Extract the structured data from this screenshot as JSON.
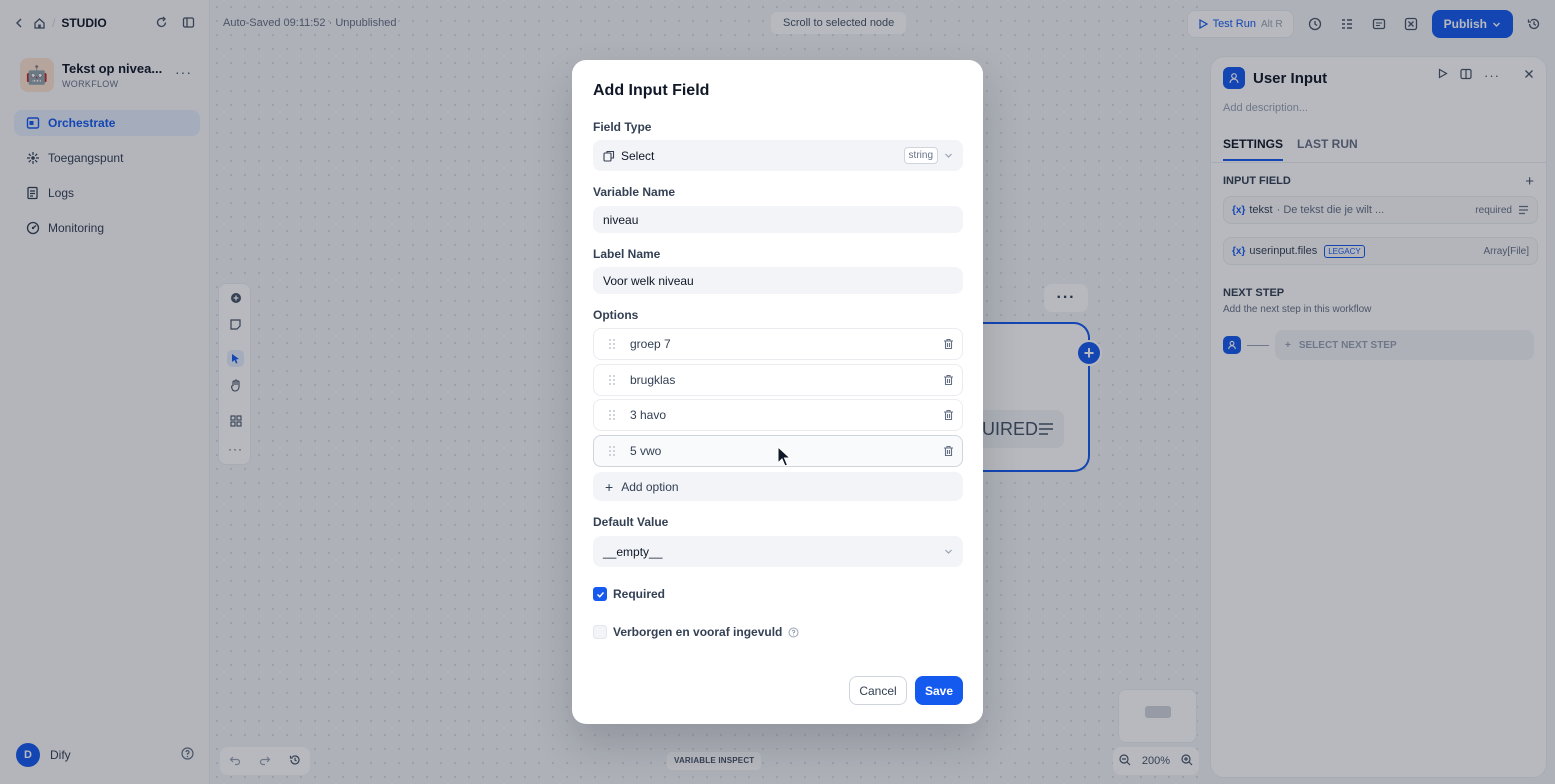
{
  "sidebar": {
    "breadcrumb": "STUDIO",
    "app": {
      "name": "Tekst op nivea...",
      "type": "WORKFLOW",
      "emoji": "🤖"
    },
    "nav": [
      {
        "label": "Orchestrate",
        "icon": "orchestrate-icon",
        "active": true
      },
      {
        "label": "Toegangspunt",
        "icon": "access-point-icon",
        "active": false
      },
      {
        "label": "Logs",
        "icon": "logs-icon",
        "active": false
      },
      {
        "label": "Monitoring",
        "icon": "monitoring-icon",
        "active": false
      }
    ],
    "user": {
      "initial": "D",
      "name": "Dify"
    }
  },
  "topbar": {
    "autosave": "Auto-Saved 09:11:52 · Unpublished",
    "scroll_to_node": "Scroll to selected node",
    "test_run": "Test Run",
    "test_run_shortcut": "Alt R",
    "publish": "Publish"
  },
  "canvas": {
    "node_required": "UIRED",
    "variable_inspect": "VARIABLE INSPECT",
    "zoom": "200%"
  },
  "right_panel": {
    "title": "User Input",
    "description_placeholder": "Add description...",
    "tabs": [
      "SETTINGS",
      "LAST RUN"
    ],
    "input_field_header": "INPUT FIELD",
    "fields": [
      {
        "name": "tekst",
        "hint": "· De tekst die je wilt ...",
        "meta": "required"
      },
      {
        "name": "userinput.files",
        "badge": "LEGACY",
        "meta": "Array[File]"
      }
    ],
    "next_step_header": "NEXT STEP",
    "next_step_sub": "Add the next step in this workflow",
    "select_next_step": "SELECT NEXT STEP"
  },
  "modal": {
    "title": "Add Input Field",
    "field_type_label": "Field Type",
    "field_type_value": "Select",
    "field_type_badge": "string",
    "variable_name_label": "Variable Name",
    "variable_name_value": "niveau",
    "label_name_label": "Label Name",
    "label_name_value": "Voor welk niveau",
    "options_label": "Options",
    "options": [
      "groep 7",
      "brugklas",
      "3 havo",
      "5 vwo"
    ],
    "add_option": "Add option",
    "default_value_label": "Default Value",
    "default_value": "__empty__",
    "required_label": "Required",
    "required_checked": true,
    "hidden_label": "Verborgen en vooraf ingevuld",
    "hidden_checked": false,
    "cancel": "Cancel",
    "save": "Save"
  },
  "colors": {
    "accent": "#155aef",
    "overlay": "rgba(16,24,40,0.30)"
  }
}
